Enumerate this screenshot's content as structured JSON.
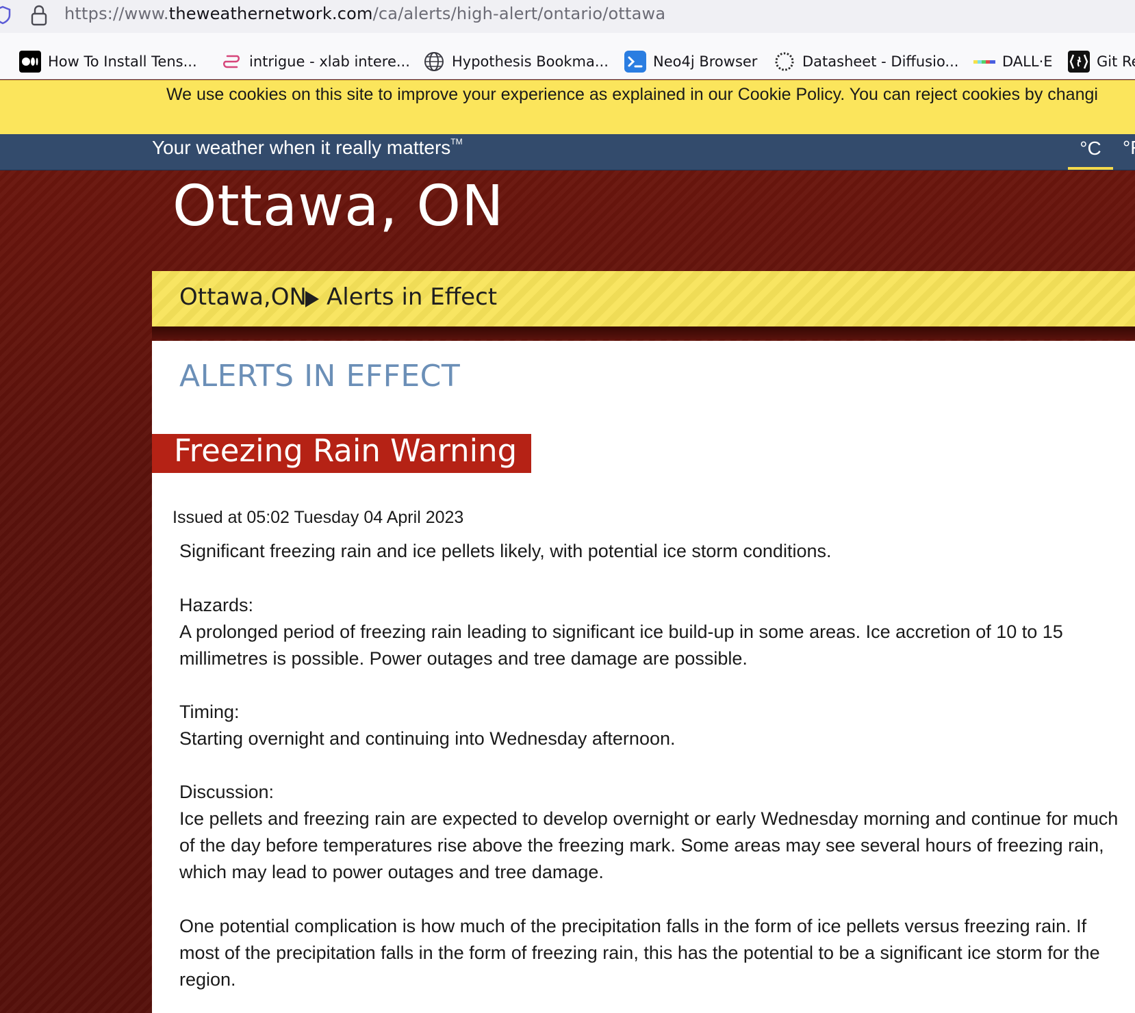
{
  "browser": {
    "url_prefix": "https://www.",
    "url_host": "theweathernetwork.com",
    "url_path": "/ca/alerts/high-alert/ontario/ottawa"
  },
  "bookmarks": [
    {
      "label": "How To Install Tens...",
      "icon": "medium-icon"
    },
    {
      "label": "intrigue - xlab intere...",
      "icon": "link-icon"
    },
    {
      "label": "Hypothesis Bookma...",
      "icon": "globe-icon"
    },
    {
      "label": "Neo4j Browser",
      "icon": "terminal-icon"
    },
    {
      "label": "Datasheet - Diffusio...",
      "icon": "dotted-circle-icon"
    },
    {
      "label": "DALL·E",
      "icon": "rainbow-bar-icon"
    },
    {
      "label": "Git Re",
      "icon": "git-icon"
    }
  ],
  "cookie_banner": {
    "text": "We use cookies on this site to improve your experience as explained in our Cookie Policy. You can reject cookies by changi"
  },
  "header": {
    "tagline": "Your weather when it really matters",
    "tagline_mark": "TM",
    "unit_celsius": "°C",
    "unit_other": "°F"
  },
  "location": {
    "title": "Ottawa, ON"
  },
  "breadcrumb": {
    "city": "Ottawa,ON",
    "section": "Alerts in Effect"
  },
  "alerts": {
    "heading": "ALERTS IN EFFECT",
    "warning_title": "Freezing Rain Warning",
    "issued": "Issued at 05:02 Tuesday 04 April 2023",
    "summary": "Significant freezing rain and ice pellets likely, with potential ice storm conditions.",
    "hazards_label": "Hazards:",
    "hazards_text": "A prolonged period of freezing rain leading to significant ice build-up in some areas. Ice accretion of 10 to 15 millimetres is possible. Power outages and tree damage are possible.",
    "timing_label": "Timing:",
    "timing_text": "Starting overnight and continuing into Wednesday afternoon.",
    "discussion_label": "Discussion:",
    "discussion_text": "Ice pellets and freezing rain are expected to develop overnight or early Wednesday morning and continue for much of the day before temperatures rise above the freezing mark. Some areas may see several hours of freezing rain, which may lead to power outages and tree damage.",
    "complication_text": "One potential complication is how much of the precipitation falls in the form of ice pellets versus freezing rain. If most of the precipitation falls in the form of freezing rain, this has the potential to be a significant ice storm for the region."
  }
}
